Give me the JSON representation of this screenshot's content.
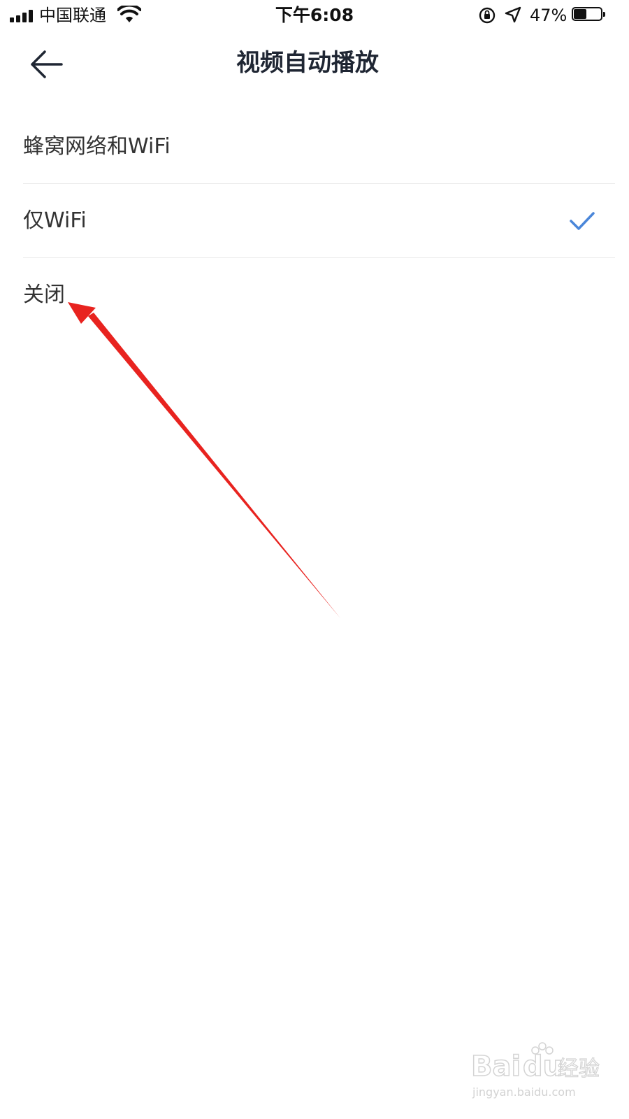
{
  "status_bar": {
    "carrier": "中国联通",
    "time": "下午6:08",
    "battery_percent": "47%",
    "battery_level": 0.47,
    "icons": [
      "signal-icon",
      "wifi-icon",
      "orientation-lock-icon",
      "location-icon",
      "battery-icon"
    ]
  },
  "nav": {
    "title": "视频自动播放",
    "back_icon": "back-arrow-icon"
  },
  "options": [
    {
      "label": "蜂窝网络和WiFi",
      "selected": false
    },
    {
      "label": "仅WiFi",
      "selected": true
    },
    {
      "label": "关闭",
      "selected": false
    }
  ],
  "colors": {
    "check": "#4a86d9",
    "annotation": "#e8231f",
    "title": "#1f2633"
  },
  "watermark": {
    "logo": "Baidu经验",
    "url": "jingyan.baidu.com"
  }
}
